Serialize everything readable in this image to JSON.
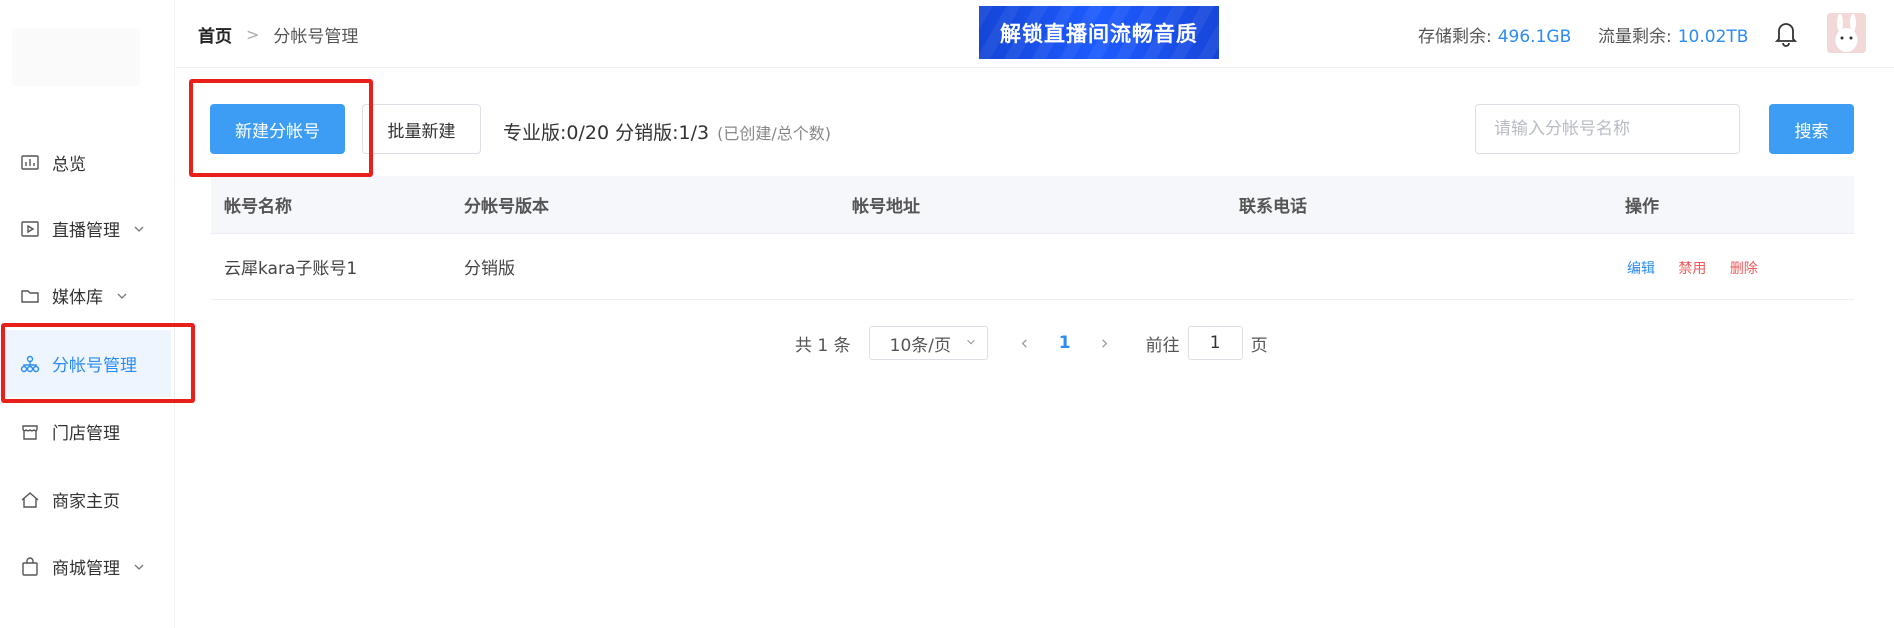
{
  "sidebar": {
    "items": [
      {
        "label": "总览",
        "icon": "chart-icon",
        "has_submenu": false,
        "active": false
      },
      {
        "label": "直播管理",
        "icon": "play-icon",
        "has_submenu": true,
        "active": false
      },
      {
        "label": "媒体库",
        "icon": "folder-icon",
        "has_submenu": true,
        "active": false
      },
      {
        "label": "分帐号管理",
        "icon": "org-chart-icon",
        "has_submenu": false,
        "active": true
      },
      {
        "label": "门店管理",
        "icon": "store-icon",
        "has_submenu": false,
        "active": false
      },
      {
        "label": "商家主页",
        "icon": "home-icon",
        "has_submenu": false,
        "active": false
      },
      {
        "label": "商城管理",
        "icon": "bag-icon",
        "has_submenu": true,
        "active": false
      }
    ]
  },
  "header": {
    "breadcrumb": {
      "home": "首页",
      "separator": ">",
      "current": "分帐号管理"
    },
    "banner_text": "解锁直播间流畅音质",
    "storage_label": "存储剩余:",
    "storage_value": "496.1GB",
    "traffic_label": "流量剩余:",
    "traffic_value": "10.02TB"
  },
  "toolbar": {
    "create_button": "新建分帐号",
    "batch_button": "批量新建",
    "stats_text": "专业版:0/20  分销版:1/3",
    "stats_note": "(已创建/总个数)",
    "search_placeholder": "请输入分帐号名称",
    "search_button": "搜索"
  },
  "table": {
    "headers": [
      "帐号名称",
      "分帐号版本",
      "帐号地址",
      "联系电话",
      "操作"
    ],
    "rows": [
      {
        "name": "云犀kara子账号1",
        "version": "分销版",
        "address": "",
        "phone": "",
        "actions": [
          "编辑",
          "禁用",
          "删除"
        ]
      }
    ]
  },
  "pagination": {
    "total": "共 1 条",
    "page_size": "10条/页",
    "current_page": "1",
    "goto_label": "前往",
    "goto_value": "1",
    "page_suffix": "页"
  },
  "colors": {
    "primary": "#3d9df5",
    "link": "#2b8cf2",
    "danger": "#f05a5a",
    "highlight_box": "#e8201c"
  }
}
